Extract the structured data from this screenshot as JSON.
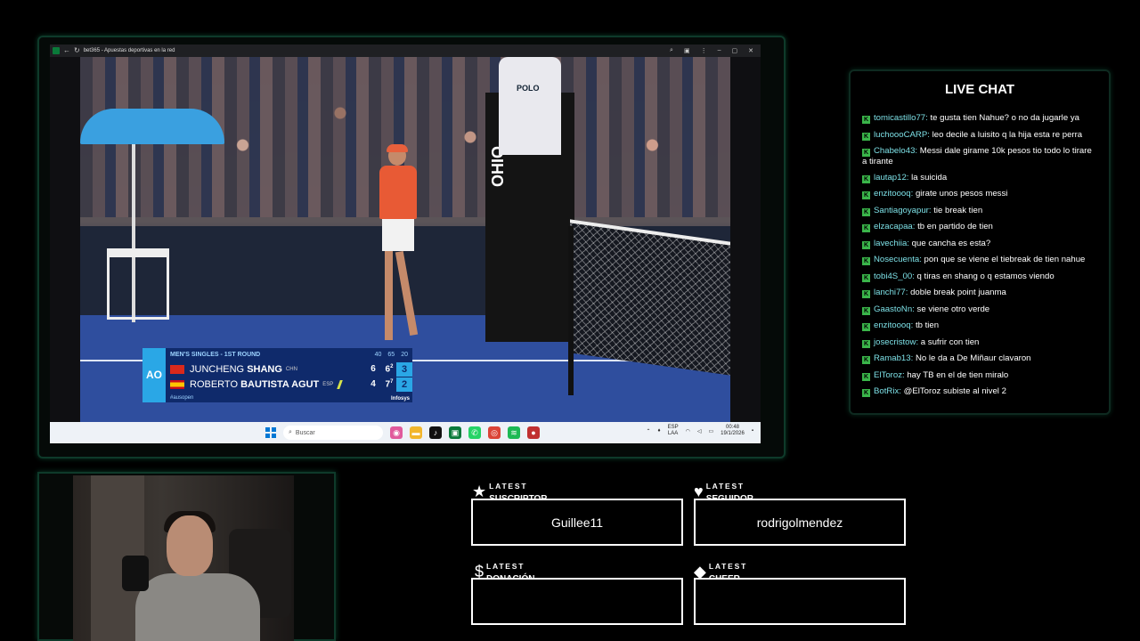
{
  "browser": {
    "title": "bet365 - Apuestas deportivas en la red",
    "icons": [
      "back-icon",
      "reload-icon",
      "zoom-icon",
      "extensions-icon",
      "more-icon",
      "minimize-icon",
      "maximize-icon",
      "close-icon"
    ]
  },
  "video": {
    "umpire_shirt": "POLO",
    "stand_brand": "OHIO"
  },
  "scoreboard": {
    "logo": "AO",
    "round": "MEN'S SINGLES - 1ST ROUND",
    "header_nums": [
      "40",
      "65",
      "20"
    ],
    "players": [
      {
        "first": "JUNCHENG",
        "last": "SHANG",
        "country": "CHN",
        "sets": [
          "6",
          "6",
          "3"
        ],
        "tiebreak": "2",
        "serving": false
      },
      {
        "first": "ROBERTO",
        "last": "BAUTISTA AGUT",
        "country": "ESP",
        "sets": [
          "4",
          "7",
          "2"
        ],
        "tiebreak": "7",
        "serving": true
      }
    ],
    "hashtag": "#ausopen",
    "sponsor": "Infosys"
  },
  "taskbar": {
    "search_placeholder": "Buscar",
    "lang_top": "ESP",
    "lang_bottom": "LAA",
    "time": "00:48",
    "date": "19/1/2026"
  },
  "chat": {
    "title": "LIVE CHAT",
    "badge": "K",
    "messages": [
      {
        "user": "tomicastillo77:",
        "text": "te gusta tien Nahue? o no da jugarle ya"
      },
      {
        "user": "luchoooCARP:",
        "text": "leo decile a luisito q la hija esta re perra"
      },
      {
        "user": "Chabelo43:",
        "text": "Messi dale girame 10k pesos tio todo lo tirare a tirante"
      },
      {
        "user": "lautap12:",
        "text": "la suicida"
      },
      {
        "user": "enzitoooq:",
        "text": "girate unos pesos messi"
      },
      {
        "user": "Santiagoyapur:",
        "text": "tie break tien"
      },
      {
        "user": "elzacapaa:",
        "text": "tb en partido de tien"
      },
      {
        "user": "lavechiia:",
        "text": "que cancha es esta?"
      },
      {
        "user": "Nosecuenta:",
        "text": "pon que se viene el tiebreak de tien nahue"
      },
      {
        "user": "tobi4S_00:",
        "text": "q tiras en shang o q estamos viendo"
      },
      {
        "user": "lanchi77:",
        "text": "doble break point juanma"
      },
      {
        "user": "GaastoNn:",
        "text": "se viene otro verde"
      },
      {
        "user": "enzitoooq:",
        "text": "tb tien"
      },
      {
        "user": "josecristow:",
        "text": "a sufrir con tien"
      },
      {
        "user": "Ramab13:",
        "text": "No le da a De Miñaur clavaron"
      },
      {
        "user": "ElToroz:",
        "text": "hay TB en el de tien miralo"
      },
      {
        "user": "BotRix:",
        "text": "@ElToroz subiste al nivel 2"
      }
    ]
  },
  "widgets": {
    "suscriptor": {
      "small": "LATEST",
      "big": "SUSCRIPTOR",
      "icon": "★",
      "value": "Guillee11"
    },
    "seguidor": {
      "small": "LATEST",
      "big": "SEGUIDOR",
      "icon": "♥",
      "value": "rodrigolmendez"
    },
    "donacion": {
      "small": "LATEST",
      "big": "DONACIÓN",
      "icon": "$",
      "value": ""
    },
    "cheer": {
      "small": "LATEST",
      "big": "CHEER",
      "icon": "◆",
      "value": ""
    }
  },
  "colors": {
    "frame_glow": "#0e3a2a",
    "chat_user": "#7de0e6",
    "chat_badge": "#3ab54a",
    "score_bg": "#0f2a6b",
    "score_accent": "#2aa7e6"
  }
}
